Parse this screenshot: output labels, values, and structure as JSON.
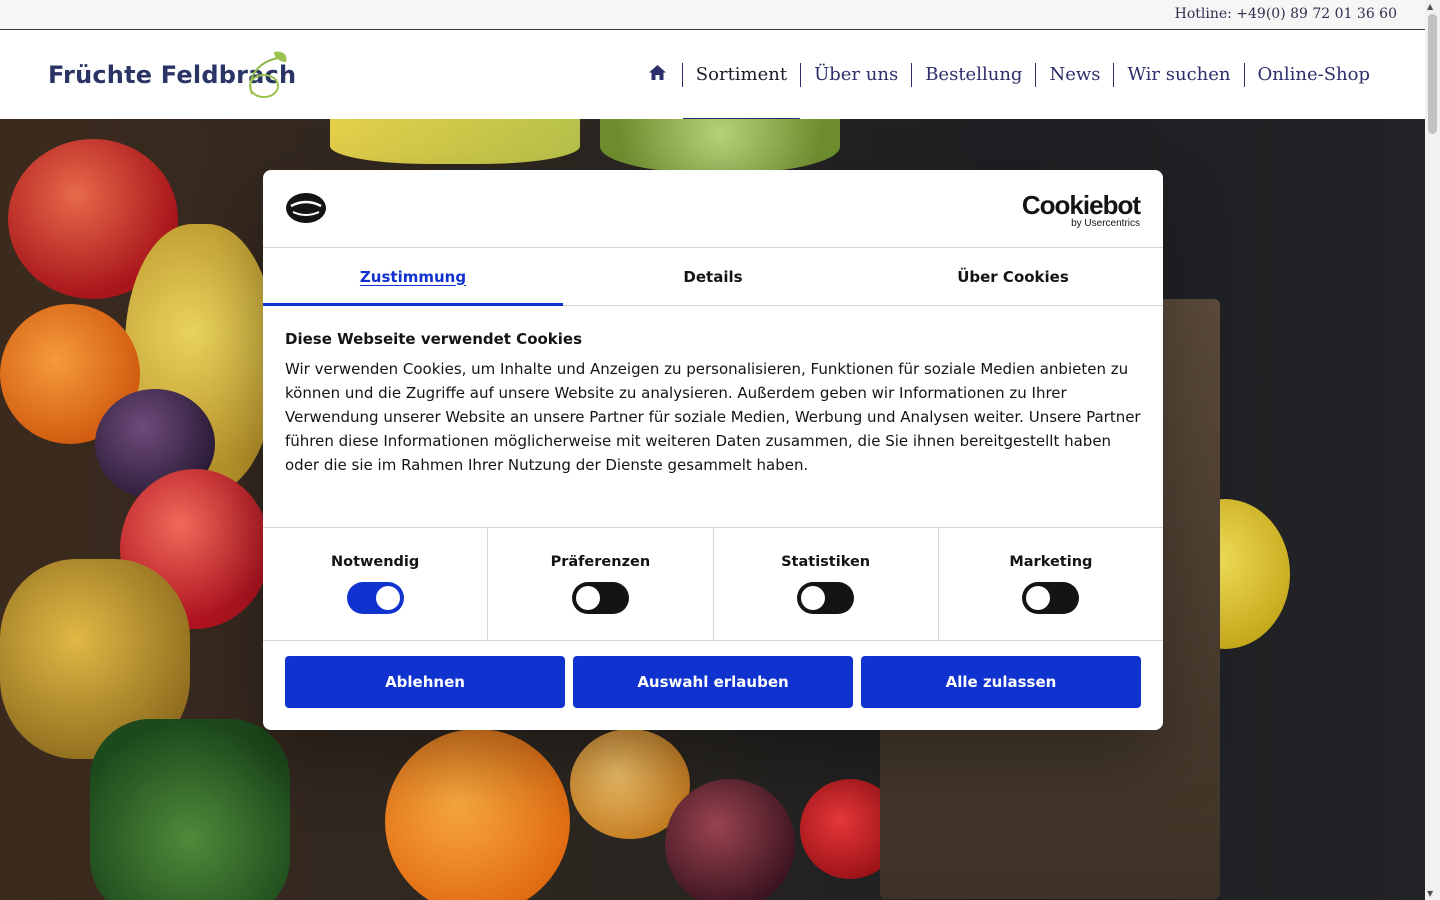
{
  "topbar": {
    "hotline": "Hotline: +49(0) 89 72 01 36 60"
  },
  "header": {
    "logo_text": "Früchte Feldbrach",
    "nav": [
      {
        "label": "Sortiment"
      },
      {
        "label": "Über uns"
      },
      {
        "label": "Bestellung"
      },
      {
        "label": "News"
      },
      {
        "label": "Wir suchen"
      },
      {
        "label": "Online-Shop"
      }
    ]
  },
  "cookie_dialog": {
    "brand": {
      "main": "Cookiebot",
      "sub": "by Usercentrics"
    },
    "tabs": [
      "Zustimmung",
      "Details",
      "Über Cookies"
    ],
    "active_tab": "Zustimmung",
    "title": "Diese Webseite verwendet Cookies",
    "text": "Wir verwenden Cookies, um Inhalte und Anzeigen zu personalisieren, Funktionen für soziale Medien anbieten zu können und die Zugriffe auf unsere Website zu analysieren. Außerdem geben wir Informationen zu Ihrer Verwendung unserer Website an unsere Partner für soziale Medien, Werbung und Analysen weiter. Unsere Partner führen diese Informationen möglicherweise mit weiteren Daten zusammen, die Sie ihnen bereitgestellt haben oder die sie im Rahmen Ihrer Nutzung der Dienste gesammelt haben.",
    "toggles": [
      {
        "label": "Notwendig",
        "state": "on"
      },
      {
        "label": "Präferenzen",
        "state": "off"
      },
      {
        "label": "Statistiken",
        "state": "off"
      },
      {
        "label": "Marketing",
        "state": "off"
      }
    ],
    "buttons": {
      "decline": "Ablehnen",
      "allow_selection": "Auswahl erlauben",
      "allow_all": "Alle zulassen"
    }
  },
  "colors": {
    "accent": "#1032cf",
    "nav": "#2d2f6b"
  }
}
